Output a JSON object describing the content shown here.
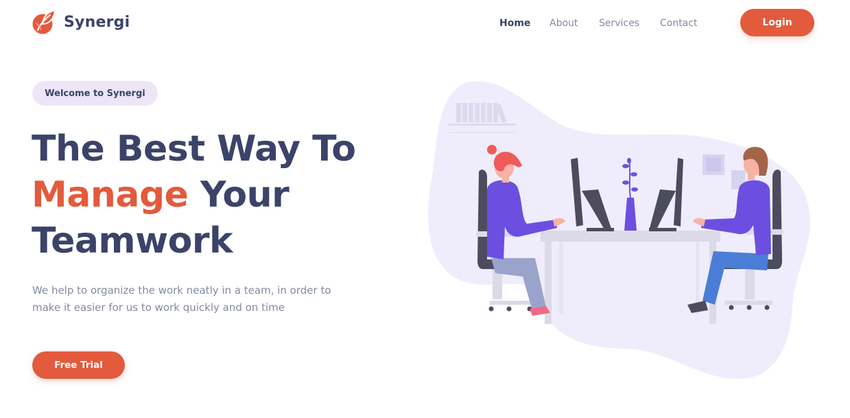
{
  "brand": {
    "name": "Synergi",
    "accent_color": "#e35a3d",
    "text_color": "#3b4368",
    "logo_icon": "leaf-icon"
  },
  "nav": {
    "items": [
      {
        "label": "Home",
        "active": true
      },
      {
        "label": "About",
        "active": false
      },
      {
        "label": "Services",
        "active": false
      },
      {
        "label": "Contact",
        "active": false
      }
    ],
    "login_label": "Login"
  },
  "hero": {
    "badge": "Welcome to Synergi",
    "headline": {
      "line1": "The Best Way To",
      "line2_accent": "Manage",
      "line2_rest": " Your",
      "line3": "Teamwork"
    },
    "description": "We help to organize the work neatly in a team, in order to make it easier for us to work quickly and on time",
    "cta_label": "Free Trial"
  },
  "illustration": {
    "name": "team-working-illustration",
    "blob_color": "#efedfb",
    "shirt_color": "#6c4fe0"
  }
}
